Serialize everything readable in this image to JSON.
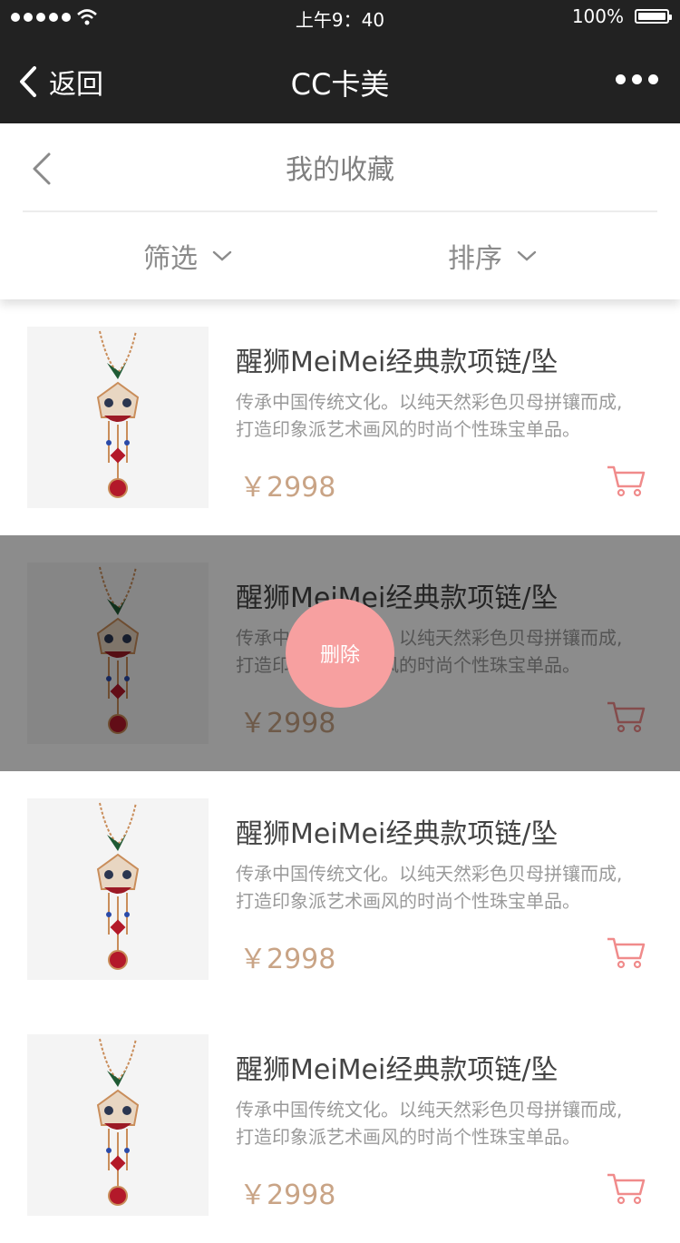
{
  "status_bar": {
    "time": "上午9：40",
    "battery": "100%"
  },
  "nav": {
    "back_label": "返回",
    "title": "CC卡美"
  },
  "subheader": {
    "title": "我的收藏",
    "filter_label": "筛选",
    "sort_label": "排序"
  },
  "items": [
    {
      "name": "醒狮MeiMei经典款项链/坠",
      "desc_line1": "传承中国传统文化。以纯天然彩色贝母拼镶而成,",
      "desc_line2": "打造印象派艺术画风的时尚个性珠宝单品。",
      "price": "￥2998"
    },
    {
      "name": "醒狮MeiMei经典款项链/坠",
      "desc_line1": "传承中国传统文化。以纯天然彩色贝母拼镶而成,",
      "desc_line2": "打造印象派艺术画风的时尚个性珠宝单品。",
      "price": "￥2998",
      "delete_label": "删除"
    },
    {
      "name": "醒狮MeiMei经典款项链/坠",
      "desc_line1": "传承中国传统文化。以纯天然彩色贝母拼镶而成,",
      "desc_line2": "打造印象派艺术画风的时尚个性珠宝单品。",
      "price": "￥2998"
    },
    {
      "name": "醒狮MeiMei经典款项链/坠",
      "desc_line1": "传承中国传统文化。以纯天然彩色贝母拼镶而成,",
      "desc_line2": "打造印象派艺术画风的时尚个性珠宝单品。",
      "price": "￥2998"
    }
  ],
  "colors": {
    "nav_bg": "#222222",
    "price": "#c9a486",
    "cart": "#f08b8b",
    "delete_button": "#f7a0a0"
  },
  "icons": [
    "chevron-left-icon",
    "more-icon",
    "chevron-down-icon",
    "shopping-cart-icon",
    "wifi-icon",
    "battery-icon"
  ]
}
